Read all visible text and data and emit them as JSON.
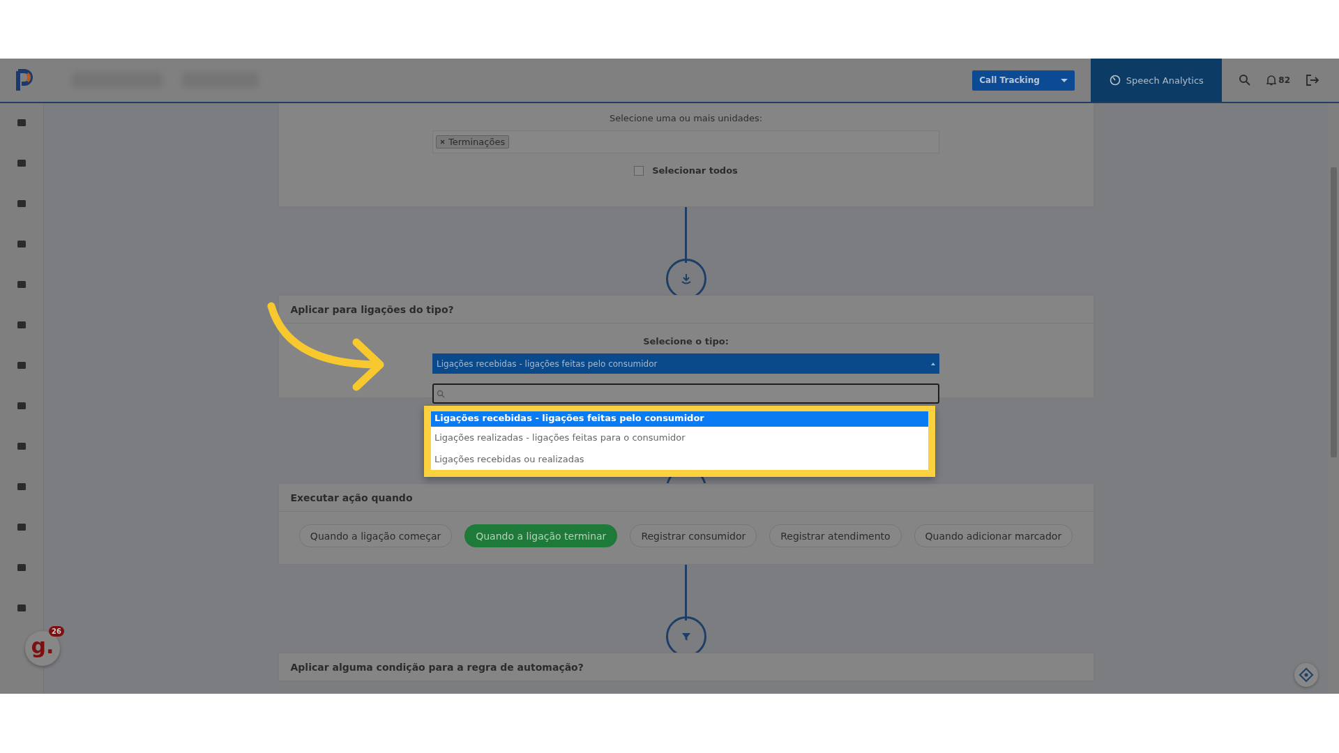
{
  "topbar": {
    "product_button": "Call Tracking",
    "analytics_tab": "Speech Analytics",
    "notification_count": "82"
  },
  "units_card": {
    "label": "Selecione uma ou mais unidades:",
    "tags": [
      "Terminações"
    ],
    "select_all": {
      "label": "Selecionar todos",
      "checked": false
    }
  },
  "type_card": {
    "title": "Aplicar para ligações do tipo?",
    "label": "Selecione o tipo:",
    "value": "Ligações recebidas - ligações feitas pelo consumidor",
    "dropdown": {
      "options": [
        {
          "label": "Ligações recebidas - ligações feitas pelo consumidor",
          "selected": true
        },
        {
          "label": "Ligações realizadas - ligações feitas para o consumidor",
          "selected": false
        },
        {
          "label": "Ligações recebidas ou realizadas",
          "selected": false
        }
      ]
    }
  },
  "action_card": {
    "title": "Executar ação quando",
    "options": [
      {
        "label": "Quando a ligação começar",
        "selected": false
      },
      {
        "label": "Quando a ligação terminar",
        "selected": true
      },
      {
        "label": "Registrar consumidor",
        "selected": false
      },
      {
        "label": "Registrar atendimento",
        "selected": false
      },
      {
        "label": "Quando adicionar marcador",
        "selected": false
      }
    ]
  },
  "condition_card": {
    "title": "Aplicar alguma condição para a regra de automação?"
  },
  "assistant_badge": {
    "logo": "g.",
    "count": "26"
  }
}
